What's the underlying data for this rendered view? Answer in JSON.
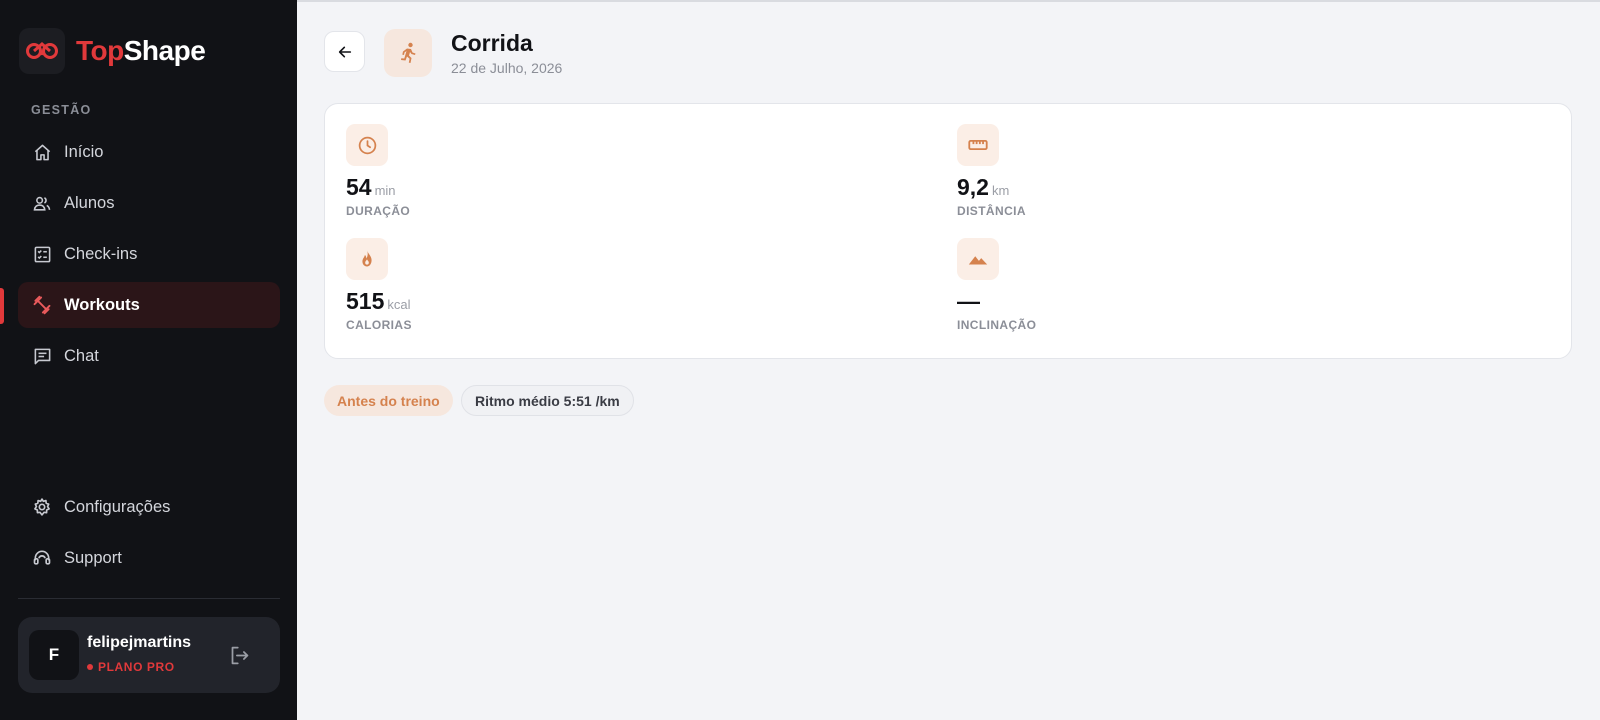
{
  "brand": {
    "part1": "Top",
    "part2": "Shape"
  },
  "sidebar": {
    "section_label": "GESTÃO",
    "items": [
      {
        "label": "Início",
        "icon": "home-icon"
      },
      {
        "label": "Alunos",
        "icon": "users-icon"
      },
      {
        "label": "Check-ins",
        "icon": "checklist-icon"
      },
      {
        "label": "Workouts",
        "icon": "dumbbell-icon",
        "active": true
      },
      {
        "label": "Chat",
        "icon": "chat-icon"
      }
    ],
    "bottom_items": [
      {
        "label": "Configurações",
        "icon": "gear-icon"
      },
      {
        "label": "Support",
        "icon": "headset-icon"
      }
    ]
  },
  "user": {
    "initial": "F",
    "name": "felipejmartins",
    "plan": "PLANO PRO"
  },
  "workout": {
    "title": "Corrida",
    "date": "22 de Julho, 2026",
    "icon": "running-icon"
  },
  "stats": {
    "duration": {
      "value": "54",
      "unit": "min",
      "label": "DURAÇÃO",
      "icon": "clock-icon"
    },
    "distance": {
      "value": "9,2",
      "unit": "km",
      "label": "DISTÂNCIA",
      "icon": "ruler-icon"
    },
    "calories": {
      "value": "515",
      "unit": "kcal",
      "label": "CALORIAS",
      "icon": "flame-icon"
    },
    "incline": {
      "value": "—",
      "unit": "",
      "label": "INCLINAÇÃO",
      "icon": "mountain-icon"
    }
  },
  "chips": {
    "timing": "Antes do treino",
    "pace": "Ritmo médio 5:51 /km"
  },
  "colors": {
    "accent": "#e1393b",
    "orange": "#d5824e",
    "sidebar_bg": "#111216"
  }
}
